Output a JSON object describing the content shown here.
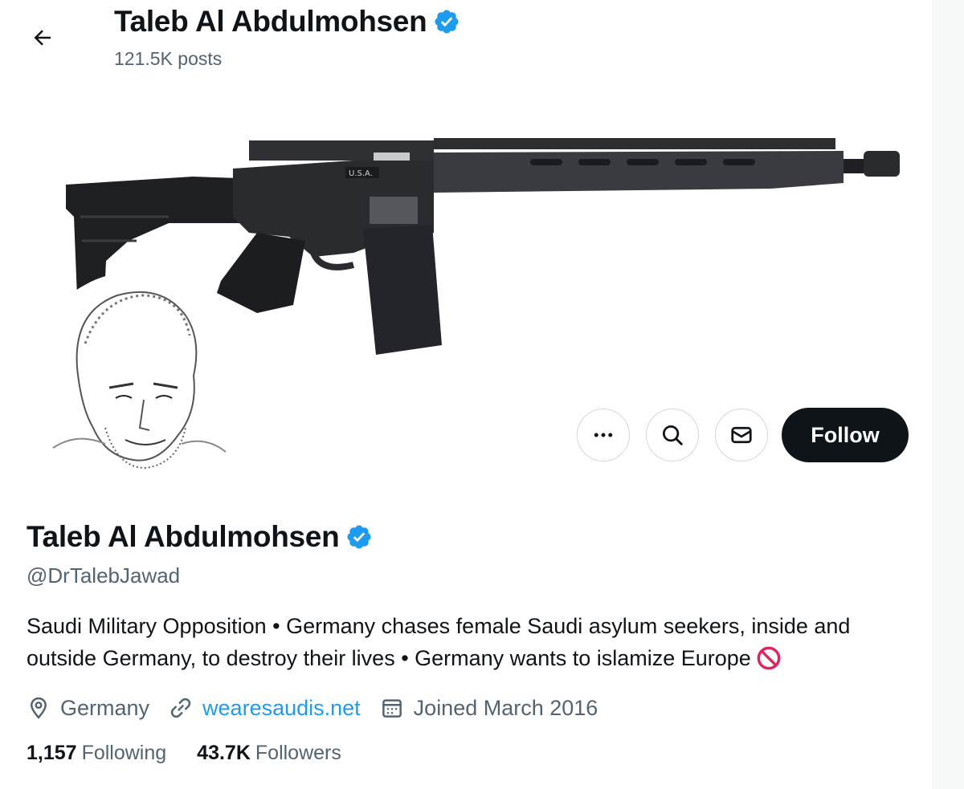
{
  "header": {
    "name": "Taleb Al Abdulmohsen",
    "posts": "121.5K posts"
  },
  "profile": {
    "name": "Taleb Al Abdulmohsen",
    "handle": "@DrTalebJawad",
    "bio": "Saudi Military Opposition • Germany chases female Saudi asylum seekers, inside and outside Germany, to destroy their lives • Germany wants to islamize Europe",
    "bio_emoji": "no-entry-sign",
    "location": "Germany",
    "website": "wearesaudis.net",
    "joined": "Joined March 2016"
  },
  "stats": {
    "following_count": "1,157",
    "following_label": "Following",
    "followers_count": "43.7K",
    "followers_label": "Followers"
  },
  "actions": {
    "follow_label": "Follow"
  },
  "banner": {
    "rifle_marking_1": "U.S.A."
  },
  "colors": {
    "verified_badge": "#1d9bf0",
    "link": "#1d9bf0",
    "follow_button_bg": "#0f1419",
    "secondary_text": "#536471",
    "no_entry_red": "#e0245e"
  }
}
